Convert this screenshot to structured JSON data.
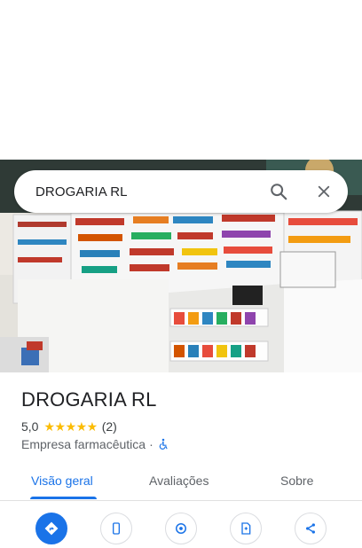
{
  "search": {
    "query": "DROGARIA RL"
  },
  "place": {
    "name": "DROGARIA RL",
    "rating": "5,0",
    "stars": "★★★★★",
    "reviews_count": "(2)",
    "category": "Empresa farmacêutica",
    "separator": "·",
    "accessibility_icon": "wheelchair-icon"
  },
  "tabs": [
    {
      "label": "Visão geral",
      "active": true
    },
    {
      "label": "Avaliações",
      "active": false
    },
    {
      "label": "Sobre",
      "active": false
    }
  ],
  "actions": [
    {
      "icon": "directions-icon",
      "primary": true
    },
    {
      "icon": "phone-icon"
    },
    {
      "icon": "location-icon"
    },
    {
      "icon": "save-icon"
    },
    {
      "icon": "share-icon"
    }
  ],
  "colors": {
    "accent": "#1a73e8",
    "star": "#fbbc04",
    "text": "#202124",
    "secondary_text": "#5f6368"
  }
}
